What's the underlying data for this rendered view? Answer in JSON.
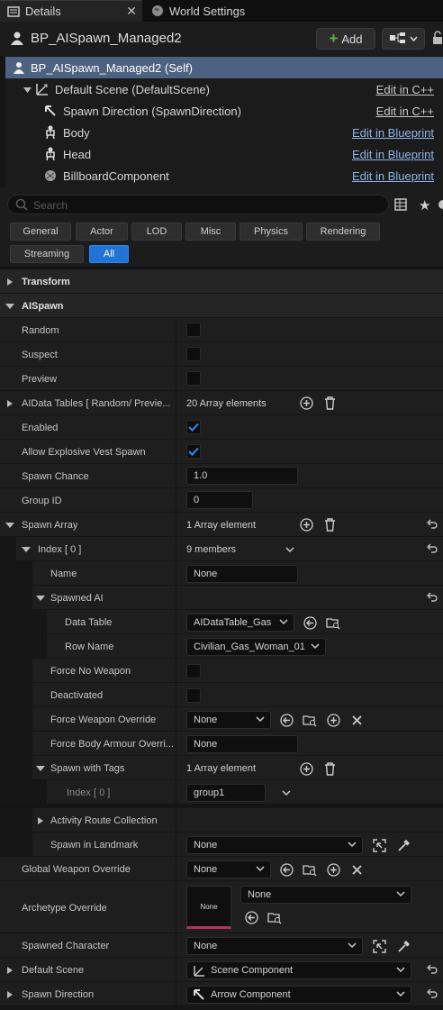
{
  "tabs": [
    {
      "label": "Details",
      "active": true
    },
    {
      "label": "World Settings",
      "active": false
    }
  ],
  "header": {
    "title": "BP_AISpawn_Managed2",
    "add_label": "Add"
  },
  "components": [
    {
      "label": "BP_AISpawn_Managed2 (Self)",
      "link": "",
      "icon": "blueprint-icon"
    },
    {
      "label": "Default Scene (DefaultScene)",
      "link": "Edit in C++",
      "icon": "scene-icon"
    },
    {
      "label": "Spawn Direction (SpawnDirection)",
      "link": "Edit in C++",
      "icon": "arrow-icon"
    },
    {
      "label": "Body",
      "link": "Edit in Blueprint",
      "icon": "skeleton-icon"
    },
    {
      "label": "Head",
      "link": "Edit in Blueprint",
      "icon": "skeleton-icon"
    },
    {
      "label": "BillboardComponent",
      "link": "Edit in Blueprint",
      "icon": "billboard-icon"
    }
  ],
  "search": {
    "placeholder": "Search"
  },
  "categories": [
    "General",
    "Actor",
    "LOD",
    "Misc",
    "Physics",
    "Rendering",
    "Streaming",
    "All"
  ],
  "sections": {
    "transform": "Transform",
    "aispawn": "AISpawn"
  },
  "props": {
    "random": "Random",
    "suspect": "Suspect",
    "preview": "Preview",
    "aidata": "AIData Tables [ Random/ Previe...",
    "aidata_val": "20 Array elements",
    "enabled": "Enabled",
    "vest": "Allow Explosive Vest Spawn",
    "chance": "Spawn Chance",
    "chance_val": "1.0",
    "group": "Group ID",
    "group_val": "0",
    "spawn_array": "Spawn Array",
    "spawn_array_val": "1 Array element",
    "index0": "Index [ 0 ]",
    "index0_val": "9 members",
    "name": "Name",
    "name_val": "None",
    "spawned_ai": "Spawned AI",
    "data_table": "Data Table",
    "data_table_val": "AIDataTable_Gas",
    "row_name": "Row Name",
    "row_name_val": "Civilian_Gas_Woman_01",
    "force_no_weapon": "Force No Weapon",
    "deactivated": "Deactivated",
    "force_weapon": "Force Weapon Override",
    "force_weapon_val": "None",
    "force_armour": "Force Body Armour Overri...",
    "force_armour_val": "None",
    "tags": "Spawn with Tags",
    "tags_val": "1 Array element",
    "tag_index": "Index [ 0 ]",
    "tag_index_val": "group1",
    "activity": "Activity Route Collection",
    "landmark": "Spawn in Landmark",
    "landmark_val": "None",
    "global_weapon": "Global Weapon Override",
    "global_weapon_val": "None",
    "archetype": "Archetype Override",
    "archetype_val": "None",
    "archetype_thumb": "None",
    "spawned_char": "Spawned Character",
    "spawned_char_val": "None",
    "default_scene": "Default Scene",
    "default_scene_val": "Scene Component",
    "spawn_dir": "Spawn Direction",
    "spawn_dir_val": "Arrow Component"
  },
  "colors": {
    "accent": "#1f74d6",
    "selection": "#4c6280",
    "link": "#8fb4e8",
    "check": "#2b8cf0",
    "add_plus": "#5fb341"
  }
}
